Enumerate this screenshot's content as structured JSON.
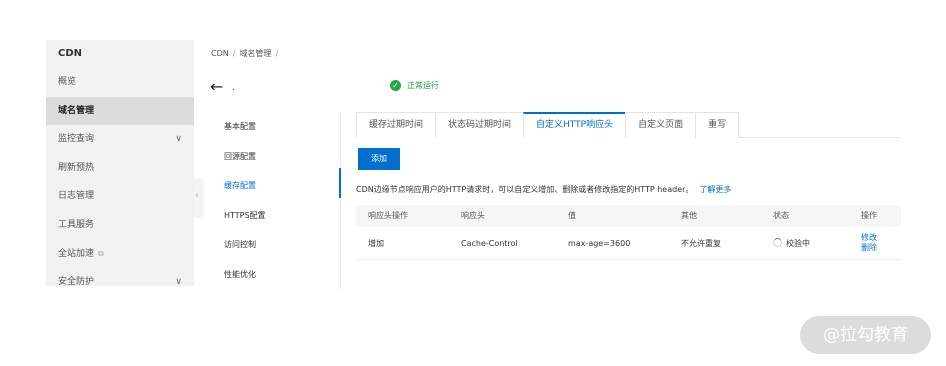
{
  "sidebar": {
    "title": "CDN",
    "items": [
      {
        "label": "概览"
      },
      {
        "label": "域名管理",
        "active": true
      },
      {
        "label": "监控查询",
        "chevron": "∨"
      },
      {
        "label": "刷新预热"
      },
      {
        "label": "日志管理"
      },
      {
        "label": "工具服务"
      },
      {
        "label": "全站加速",
        "ext": "⧉"
      },
      {
        "label": "安全防护",
        "chevron": "∨"
      }
    ]
  },
  "collapse_icon": "‹",
  "breadcrumb": [
    "CDN",
    "域名管理"
  ],
  "breadcrumb_sep": "/",
  "header": {
    "back_icon": "←",
    "domain": ".",
    "status_icon": "✓",
    "status": "正常运行"
  },
  "subnav": [
    "基本配置",
    "回源配置",
    "缓存配置",
    "HTTPS配置",
    "访问控制",
    "性能优化"
  ],
  "tabs": [
    "缓存过期时间",
    "状态码过期时间",
    "自定义HTTP响应头",
    "自定义页面",
    "重写"
  ],
  "active_tab": 2,
  "add_button": "添加",
  "description": "CDN边缘节点响应用户的HTTP请求时，可以自定义增加、删除或者修改指定的HTTP header。",
  "learn_more": "了解更多",
  "table": {
    "headers": [
      "响应头操作",
      "响应头",
      "值",
      "其他",
      "状态",
      "操作"
    ],
    "rows": [
      {
        "op": "增加",
        "header": "Cache-Control",
        "value": "max-age=3600",
        "other": "不允许重复",
        "status": "校验中",
        "actions": [
          "修改",
          "删除"
        ]
      }
    ]
  },
  "watermark": "@拉勾教育",
  "colors": {
    "accent": "#0070cc",
    "success": "#22a846",
    "sidebar_bg": "#f2f2f2"
  }
}
